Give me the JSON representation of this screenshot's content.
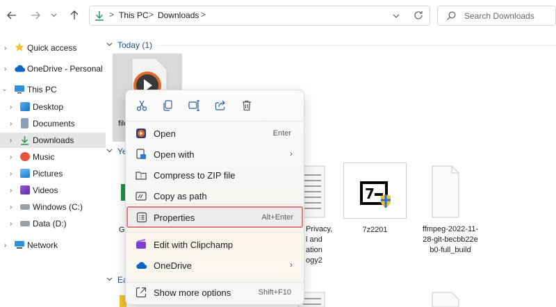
{
  "address": {
    "segments": [
      "This PC",
      "Downloads"
    ]
  },
  "search": {
    "placeholder": "Search Downloads"
  },
  "sidebar": {
    "items": [
      {
        "label": "Quick access"
      },
      {
        "label": "OneDrive - Personal"
      },
      {
        "label": "This PC"
      },
      {
        "label": "Desktop"
      },
      {
        "label": "Documents"
      },
      {
        "label": "Downloads"
      },
      {
        "label": "Music"
      },
      {
        "label": "Pictures"
      },
      {
        "label": "Videos"
      },
      {
        "label": "Windows (C:)"
      },
      {
        "label": "Data (D:)"
      },
      {
        "label": "Network"
      }
    ]
  },
  "groups": {
    "today": "Today (1)",
    "yesterday_partial": "Ye",
    "earlier_partial": "Ea"
  },
  "files": {
    "selected_partial": "file",
    "left_partial": "G",
    "privacy_lines": [
      "Privacy,",
      "l and",
      "ation",
      "ogy2"
    ],
    "sevenzip": "7z2201",
    "ffmpeg_lines": [
      "ffmpeg-2022-11-",
      "28-git-becbb22e",
      "b0-full_build"
    ]
  },
  "context_menu": {
    "quick_actions": [
      "cut-icon",
      "copy-icon",
      "rename-icon",
      "share-icon",
      "delete-icon"
    ],
    "items": [
      {
        "label": "Open",
        "shortcut": "Enter"
      },
      {
        "label": "Open with",
        "arrow": "›"
      },
      {
        "label": "Compress to ZIP file"
      },
      {
        "label": "Copy as path"
      },
      {
        "label": "Properties",
        "shortcut": "Alt+Enter"
      },
      {
        "label": "Edit with Clipchamp"
      },
      {
        "label": "OneDrive",
        "arrow": "›"
      },
      {
        "label": "Show more options",
        "shortcut": "Shift+F10"
      }
    ]
  },
  "colors": {
    "highlight_border": "#e0777c",
    "accent": "#0067c0"
  }
}
